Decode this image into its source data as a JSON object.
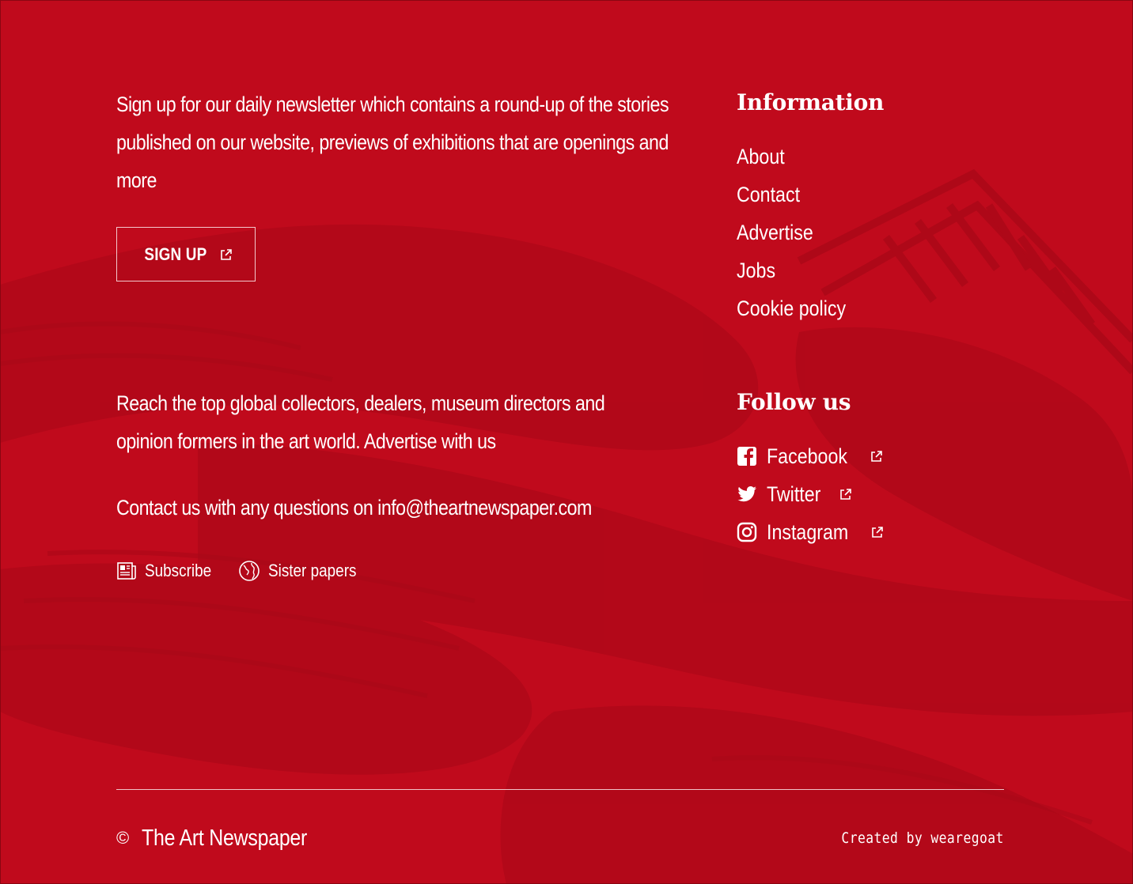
{
  "colors": {
    "background": "#c00a1c",
    "text": "#ffffff",
    "divider": "#f0c2c6"
  },
  "newsletter": {
    "text": "Sign up for our daily newsletter which contains a round-up of the stories published on our website, previews of exhibitions that are openings and more",
    "button_label": "SIGN UP",
    "button_icon": "external-link-icon"
  },
  "advertise": {
    "text": "Reach the top global collectors, dealers, museum directors and opinion formers in the art world. Advertise with us"
  },
  "contact": {
    "text": "Contact us with any questions on info@theartnewspaper.com"
  },
  "utility_links": [
    {
      "label": "Subscribe",
      "icon": "newspaper-icon"
    },
    {
      "label": "Sister papers",
      "icon": "globe-icon"
    }
  ],
  "information": {
    "heading": "Information",
    "items": [
      "About",
      "Contact",
      "Advertise",
      "Jobs",
      "Cookie policy"
    ]
  },
  "follow": {
    "heading": "Follow us",
    "items": [
      {
        "label": "Facebook",
        "icon": "facebook-icon"
      },
      {
        "label": "Twitter",
        "icon": "twitter-icon"
      },
      {
        "label": "Instagram",
        "icon": "instagram-icon"
      }
    ]
  },
  "footer": {
    "copyright_symbol": "©",
    "brand": "The Art Newspaper",
    "credit": "Created by wearegoat"
  }
}
